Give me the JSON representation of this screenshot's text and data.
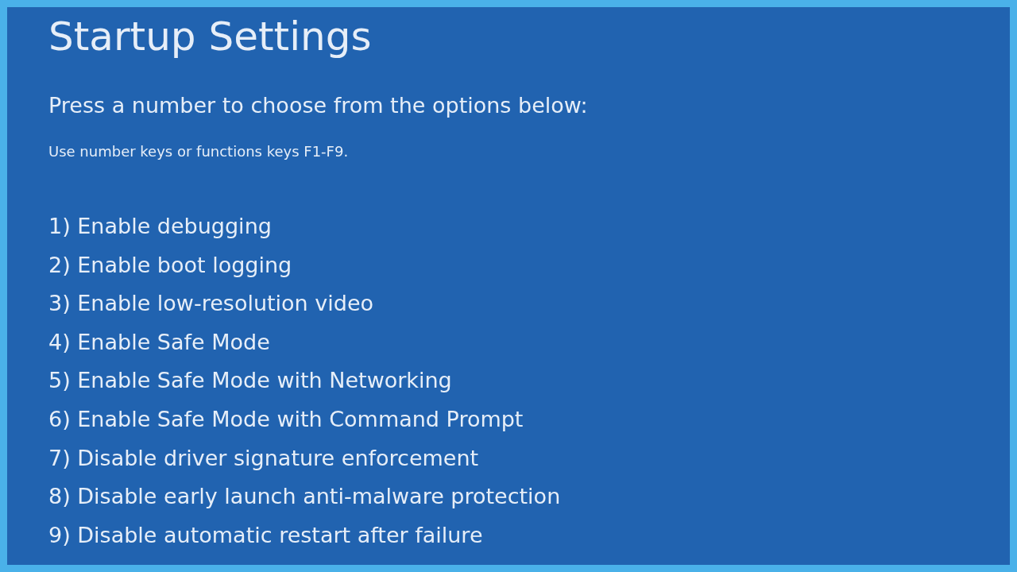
{
  "title": "Startup Settings",
  "instruction": "Press a number to choose from the options below:",
  "hint": "Use number keys or functions keys F1-F9.",
  "options": [
    {
      "label": "1) Enable debugging"
    },
    {
      "label": "2) Enable boot logging"
    },
    {
      "label": "3) Enable low-resolution video"
    },
    {
      "label": "4) Enable Safe Mode"
    },
    {
      "label": "5) Enable Safe Mode with Networking"
    },
    {
      "label": "6) Enable Safe Mode with Command Prompt"
    },
    {
      "label": "7) Disable driver signature enforcement"
    },
    {
      "label": "8) Disable early launch anti-malware protection"
    },
    {
      "label": "9) Disable automatic restart after failure"
    }
  ]
}
